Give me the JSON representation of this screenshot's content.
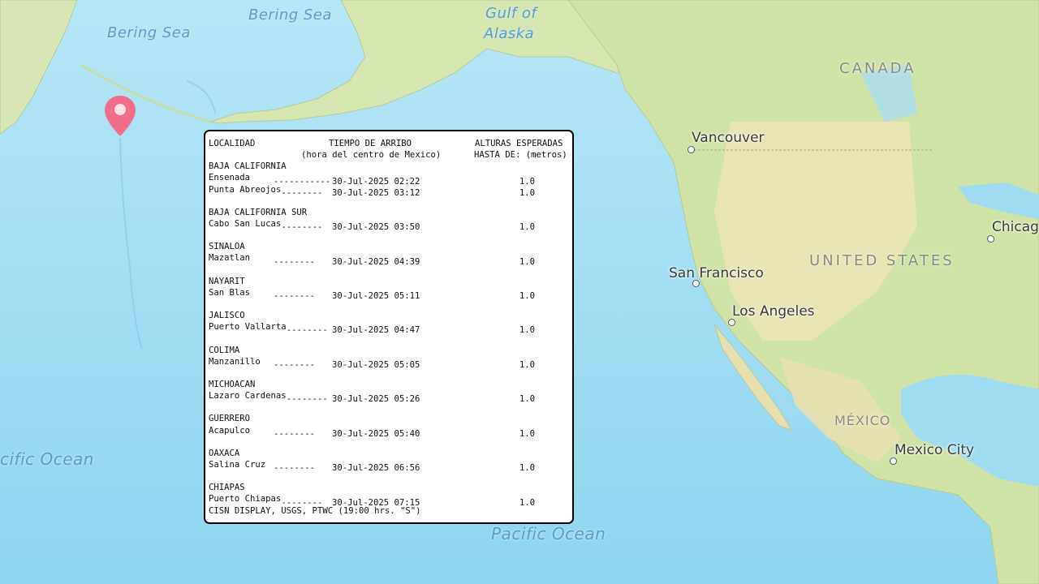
{
  "map": {
    "ocean_labels": [
      {
        "id": "bering-sea-1",
        "text": "Bering Sea"
      },
      {
        "id": "bering-sea-2",
        "text": "Bering Sea"
      },
      {
        "id": "gulf-of-alaska-1",
        "text": "Gulf of"
      },
      {
        "id": "gulf-of-alaska-2",
        "text": "Alaska"
      },
      {
        "id": "pacific-ocean-west",
        "text": "cific Ocean"
      },
      {
        "id": "pacific-ocean-south",
        "text": "Pacific Ocean"
      }
    ],
    "country_labels": {
      "canada": "CANADA",
      "united_states": "UNITED STATES",
      "mexico": "MÉXICO"
    },
    "city_labels": {
      "vancouver": "Vancouver",
      "san_francisco": "San Francisco",
      "los_angeles": "Los Angeles",
      "mexico_city": "Mexico City",
      "chicago": "Chicag"
    },
    "colors": {
      "ocean": "#9fdcf2",
      "land_green": "#cfe3a6",
      "land_tan": "#ece4b6",
      "marker": "#f26d8a"
    },
    "marker_icon": "map-pin-icon"
  },
  "bulletin": {
    "header": {
      "col1": "LOCALIDAD",
      "col2_line1": "TIEMPO DE ARRIBO",
      "col2_line2": "(hora del centro de Mexico)",
      "col3_line1": "ALTURAS ESPERADAS",
      "col3_line2": "HASTA DE: (metros)"
    },
    "groups": [
      {
        "state": "BAJA CALIFORNIA",
        "rows": [
          {
            "place": "Ensenada",
            "dashes": "-----------",
            "time": "30-Jul-2025 02:22",
            "height": "1.0"
          },
          {
            "place": "Punta Abreojos",
            "dashes": "--------",
            "time": "30-Jul-2025 03:12",
            "height": "1.0"
          }
        ]
      },
      {
        "state": "BAJA CALIFORNIA SUR",
        "rows": [
          {
            "place": "Cabo San Lucas",
            "dashes": "--------",
            "time": "30-Jul-2025 03:50",
            "height": "1.0"
          }
        ]
      },
      {
        "state": "SINALOA",
        "rows": [
          {
            "place": "Mazatlan",
            "dashes": "--------",
            "time": "30-Jul-2025 04:39",
            "height": "1.0"
          }
        ]
      },
      {
        "state": "NAYARIT",
        "rows": [
          {
            "place": "San Blas",
            "dashes": "--------",
            "time": "30-Jul-2025 05:11",
            "height": "1.0"
          }
        ]
      },
      {
        "state": "JALISCO",
        "rows": [
          {
            "place": "Puerto Vallarta",
            "dashes": "--------",
            "time": "30-Jul-2025 04:47",
            "height": "1.0"
          }
        ]
      },
      {
        "state": "COLIMA",
        "rows": [
          {
            "place": "Manzanillo",
            "dashes": "--------",
            "time": "30-Jul-2025 05:05",
            "height": "1.0"
          }
        ]
      },
      {
        "state": "MICHOACAN",
        "rows": [
          {
            "place": "Lazaro Cardenas",
            "dashes": "--------",
            "time": "30-Jul-2025 05:26",
            "height": "1.0"
          }
        ]
      },
      {
        "state": "GUERRERO",
        "rows": [
          {
            "place": "Acapulco",
            "dashes": "--------",
            "time": "30-Jul-2025 05:40",
            "height": "1.0"
          }
        ]
      },
      {
        "state": "OAXACA",
        "rows": [
          {
            "place": "Salina Cruz",
            "dashes": "--------",
            "time": "30-Jul-2025 06:56",
            "height": "1.0"
          }
        ]
      },
      {
        "state": "CHIAPAS",
        "rows": [
          {
            "place": "Puerto Chiapas",
            "dashes": "--------",
            "time": "30-Jul-2025 07:15",
            "height": "1.0"
          }
        ]
      }
    ],
    "footer": "CISN DISPLAY, USGS, PTWC (19:00 hrs. \"S\")"
  }
}
